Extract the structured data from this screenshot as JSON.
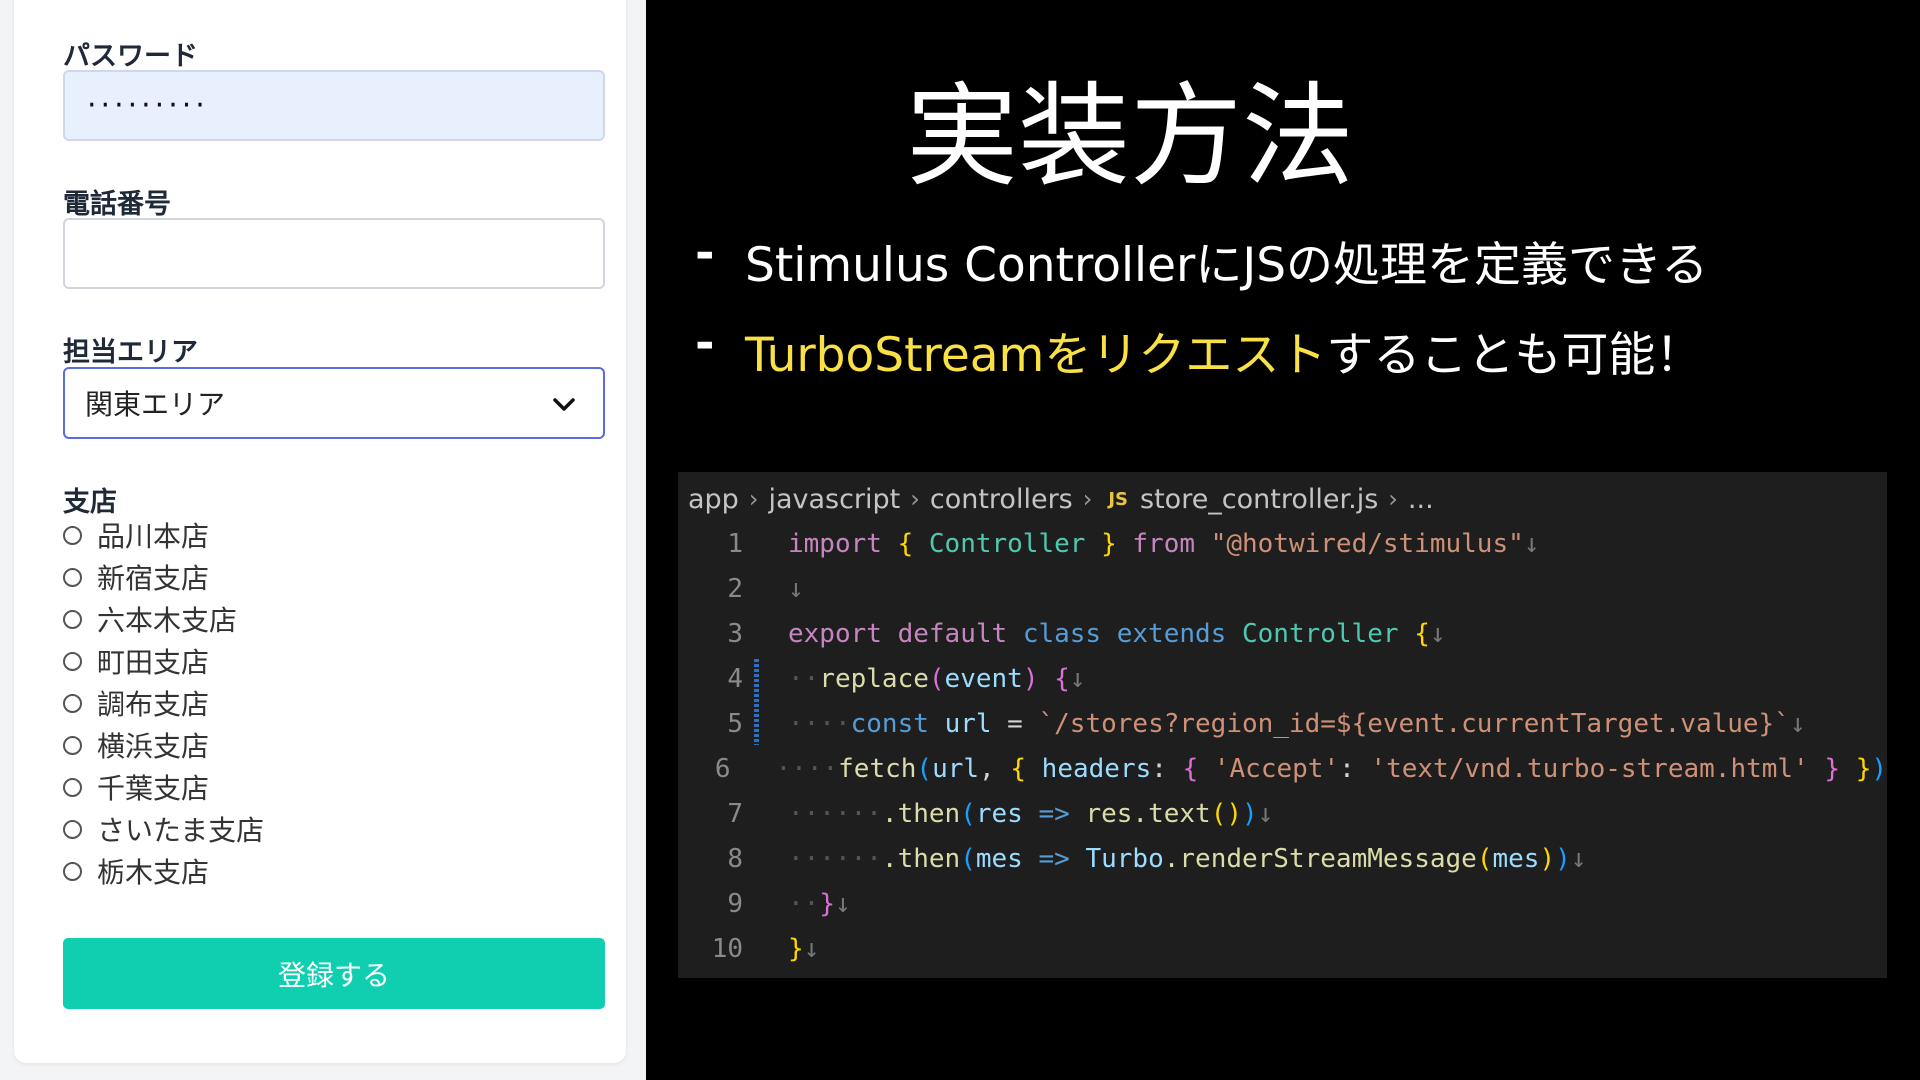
{
  "form": {
    "password_label": "パスワード",
    "password_value": "·········",
    "phone_label": "電話番号",
    "phone_value": "",
    "area_label": "担当エリア",
    "area_selected": "関東エリア",
    "branch_label": "支店",
    "branches": [
      "品川本店",
      "新宿支店",
      "六本木支店",
      "町田支店",
      "調布支店",
      "横浜支店",
      "千葉支店",
      "さいたま支店",
      "栃木支店"
    ],
    "submit_label": "登録する"
  },
  "slide": {
    "title": "実装方法",
    "bullet_dash": "-",
    "bullet1": "Stimulus ControllerにJSの処理を定義できる",
    "bullet2_highlight": "TurboStreamをリクエスト",
    "bullet2_rest": "することも可能！"
  },
  "editor": {
    "breadcrumb": [
      "app",
      "javascript",
      "controllers",
      "store_controller.js",
      "..."
    ],
    "crumb_sep": "›",
    "js_badge": "JS",
    "line_numbers": [
      "1",
      "2",
      "3",
      "4",
      "5",
      "6",
      "7",
      "8",
      "9",
      "10"
    ],
    "tokens": {
      "import": "import",
      "from": "from",
      "module": "\"@hotwired/stimulus\"",
      "controller": "Controller",
      "export": "export",
      "default": "default",
      "class": "class",
      "extends": "extends",
      "replace": "replace",
      "event": "event",
      "const": "const",
      "url": "url",
      "template": "`/stores?region_id=${event.currentTarget.value}`",
      "fetch": "fetch",
      "headers": "headers",
      "accept": "'Accept'",
      "mime": "'text/vnd.turbo-stream.html'",
      "then": ".then",
      "res": "res",
      "text_call": "res.text",
      "mes": "mes",
      "turbo": "Turbo",
      "render": ".renderStreamMessage"
    }
  },
  "colors": {
    "accent_teal": "#0fcfb0",
    "highlight_yellow": "#f8e045",
    "select_border": "#5b6be0"
  }
}
